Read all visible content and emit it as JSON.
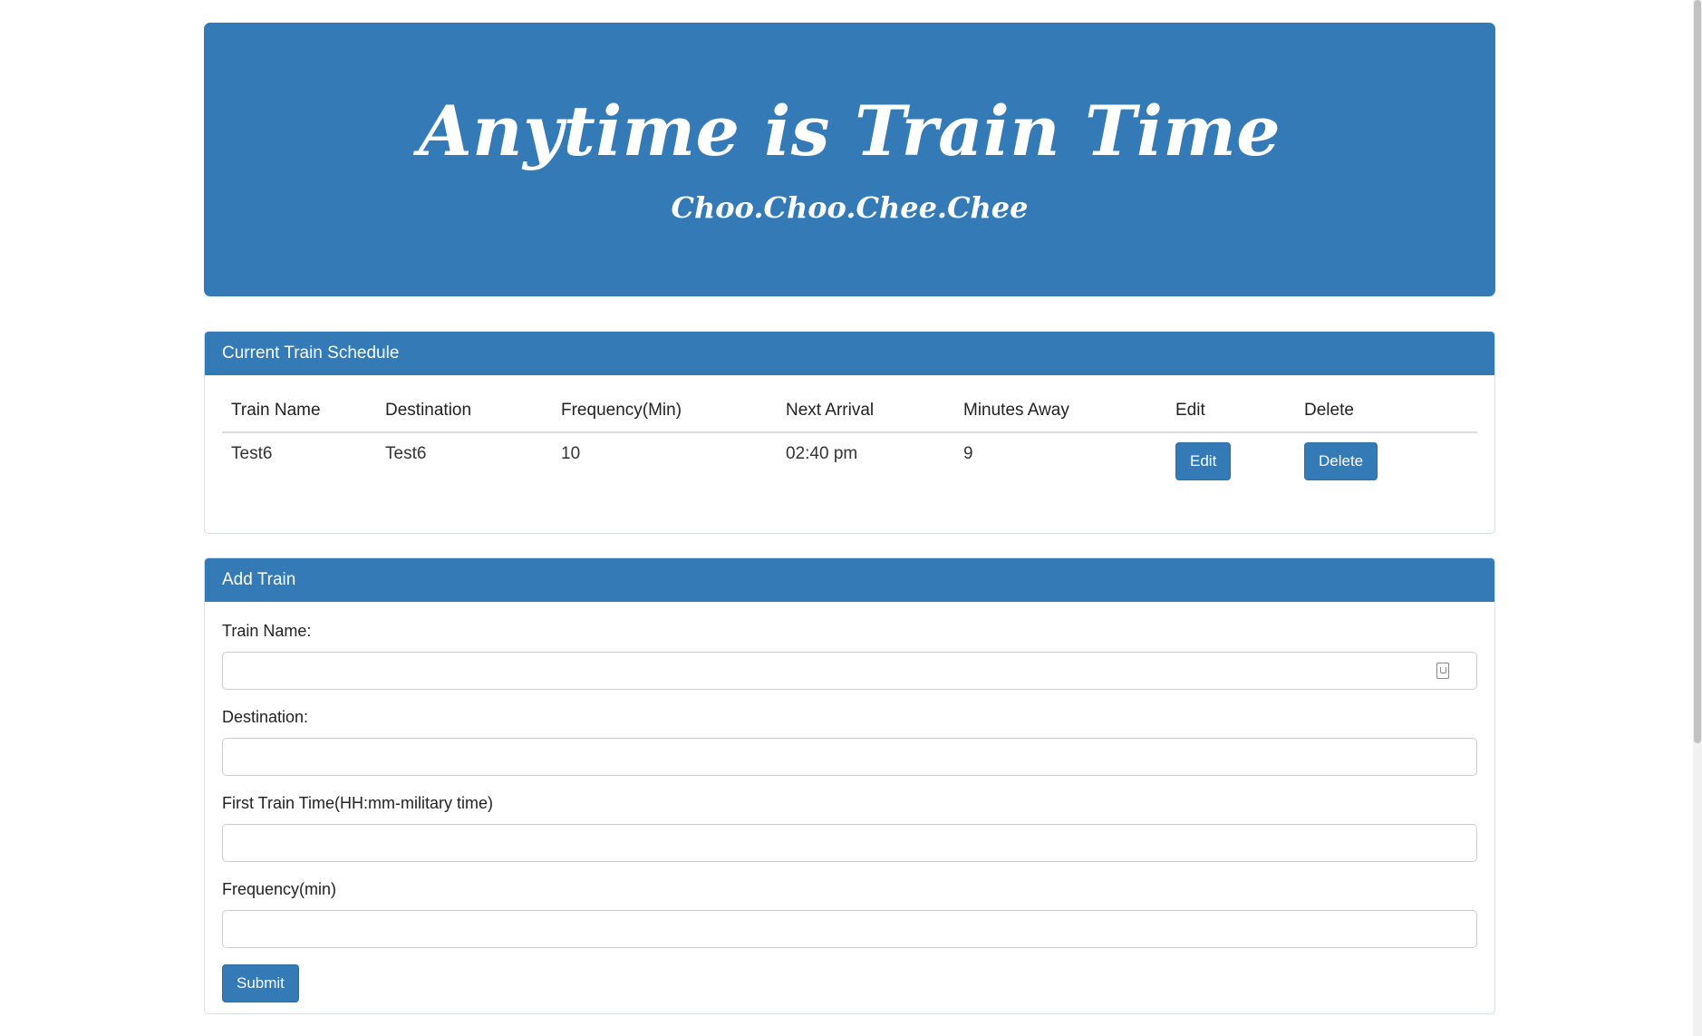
{
  "header": {
    "title": "Anytime is Train Time",
    "subtitle": "Choo.Choo.Chee.Chee"
  },
  "schedule": {
    "panel_title": "Current Train Schedule",
    "columns": [
      "Train Name",
      "Destination",
      "Frequency(Min)",
      "Next Arrival",
      "Minutes Away",
      "Edit",
      "Delete"
    ],
    "rows": [
      {
        "train_name": "Test6",
        "destination": "Test6",
        "frequency": "10",
        "next_arrival": "02:40 pm",
        "minutes_away": "9",
        "edit_label": "Edit",
        "delete_label": "Delete"
      }
    ]
  },
  "add_train": {
    "panel_title": "Add Train",
    "fields": [
      {
        "label": "Train Name:",
        "value": ""
      },
      {
        "label": "Destination:",
        "value": ""
      },
      {
        "label": "First Train Time(HH:mm-military time)",
        "value": ""
      },
      {
        "label": "Frequency(min)",
        "value": ""
      }
    ],
    "submit_label": "Submit"
  },
  "colors": {
    "primary": "#337ab7",
    "background": "#ffffff"
  },
  "icons": {
    "autofill": "contact-card-icon"
  }
}
